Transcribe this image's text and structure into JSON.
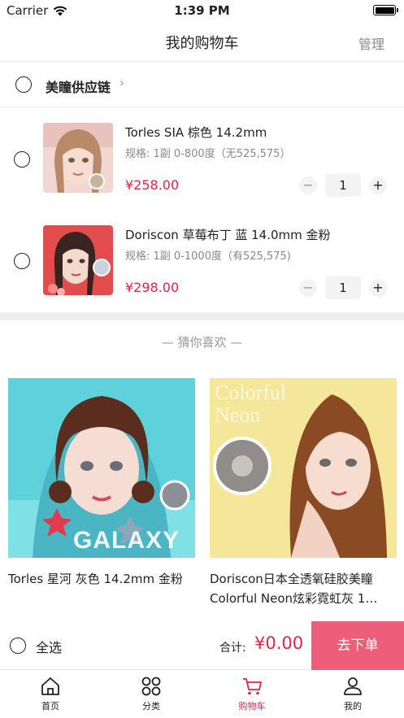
{
  "status_bar": {
    "carrier": "Carrier",
    "time": "1:39 PM",
    "battery_level": 1.0
  },
  "nav": {
    "title": "我的购物车",
    "manage": "管理"
  },
  "shop": {
    "name": "美瞳供应链",
    "chevron": "›"
  },
  "cart_items": [
    {
      "title": "Torles SIA 棕色 14.2mm",
      "spec": "规格: 1副 0-800度（无525,575）",
      "price": "¥258.00",
      "quantity": "1",
      "minus": "−",
      "plus": "+"
    },
    {
      "title": "Doriscon 草莓布丁 蓝 14.0mm 金粉",
      "spec": "规格: 1副 0-1000度（有525,575)",
      "price": "¥298.00",
      "quantity": "1",
      "minus": "−",
      "plus": "+"
    }
  ],
  "recommend": {
    "title": "— 猜你喜欢 —",
    "products": [
      {
        "name": "Torles 星河 灰色 14.2mm 金粉",
        "image_text": "GALAXY"
      },
      {
        "name": "Doriscon日本全透氧硅胶美瞳Colorful Neon炫彩霓虹灰 1…",
        "image_text": "Colorful Neon"
      }
    ]
  },
  "bottom_bar": {
    "select_all": "全选",
    "total_label": "合计:",
    "total_value": "¥0.00",
    "checkout": "去下单"
  },
  "tabs": [
    {
      "label": "首页",
      "icon": "home-icon"
    },
    {
      "label": "分类",
      "icon": "category-icon"
    },
    {
      "label": "购物车",
      "icon": "cart-icon",
      "active": true
    },
    {
      "label": "我的",
      "icon": "user-icon"
    }
  ],
  "colors": {
    "accent": "#e0244a",
    "checkout": "#ee5d79"
  }
}
